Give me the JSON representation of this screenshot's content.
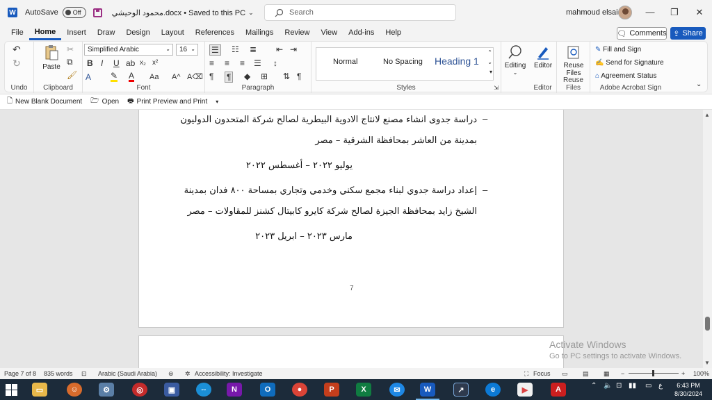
{
  "titlebar": {
    "app_icon": "W",
    "autosave_label": "AutoSave",
    "autosave_state": "Off",
    "document_title": "محمود الوحيشي.docx • Saved to this PC",
    "search_placeholder": "Search",
    "user_name": "mahmoud elsaid",
    "minimize": "—",
    "restore": "❐",
    "close": "✕"
  },
  "menu": {
    "tabs": [
      "File",
      "Home",
      "Insert",
      "Draw",
      "Design",
      "Layout",
      "References",
      "Mailings",
      "Review",
      "View",
      "Add-ins",
      "Help"
    ],
    "active_tab": "Home",
    "comments_label": "Comments",
    "share_label": "Share"
  },
  "ribbon": {
    "undo_group": "Undo",
    "clipboard_group": "Clipboard",
    "paste_label": "Paste",
    "font_group": "Font",
    "font_name": "Simplified Arabic",
    "font_size": "16",
    "paragraph_group": "Paragraph",
    "styles_group": "Styles",
    "styles": [
      "Normal",
      "No Spacing",
      "Heading 1"
    ],
    "editing_label": "Editing",
    "editor_label": "Editor",
    "editor_group": "Editor",
    "reuse_files_label": "Reuse Files",
    "reuse_files_group": "Reuse Files",
    "acrobat_items": [
      "Fill and Sign",
      "Send for Signature",
      "Agreement Status"
    ],
    "acrobat_group": "Adobe Acrobat Sign"
  },
  "quickbar": {
    "items": [
      "New Blank Document",
      "Open",
      "Print Preview and Print"
    ]
  },
  "document": {
    "bullet": "–",
    "item1_line1": "دراسة جدوى انشاء مصنع لانتاج الادوية البيطرية لصالح شركة المتحدون الدوليون",
    "item1_line2": "بمدينة من العاشر بمحافظة الشرقية – مصر",
    "item1_date": "يوليو ٢٠٢٢ – أغسطس ٢٠٢٢",
    "item2_line1": "إعداد دراسة جدوي لبناء مجمع سكني وخدمي وتجاري بمساحة ٨٠٠ فدان بمدينة",
    "item2_line2": "الشيخ زايد بمحافظة الجيزة لصالح شركة كايرو كابيتال كشنز للمقاولات – مصر",
    "item2_date": "مارس ٢٠٢٣ – ابريل ٢٠٢٣",
    "page_number": "7"
  },
  "watermark": {
    "line1": "Activate Windows",
    "line2": "Go to PC settings to activate Windows."
  },
  "statusbar": {
    "page": "Page 7 of 8",
    "words": "835 words",
    "language": "Arabic (Saudi Arabia)",
    "accessibility": "Accessibility: Investigate",
    "focus": "Focus",
    "zoom": "100%",
    "zoom_minus": "−",
    "zoom_plus": "+"
  },
  "taskbar": {
    "time": "6:43 PM",
    "date": "8/30/2024",
    "lang_indicator": "ع"
  }
}
